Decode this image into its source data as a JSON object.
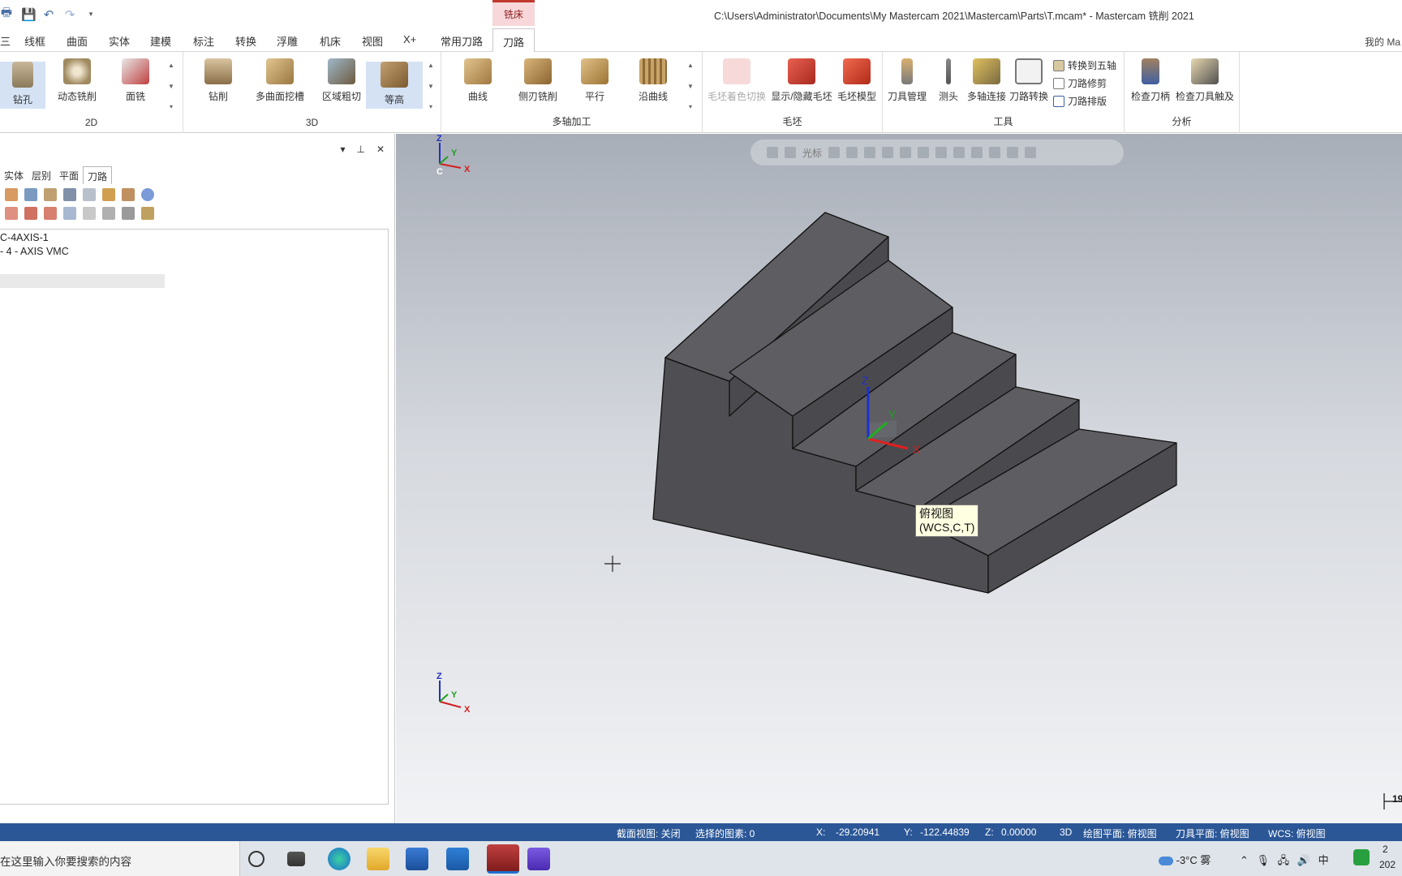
{
  "window": {
    "title": "C:\\Users\\Administrator\\Documents\\My Mastercam 2021\\Mastercam\\Parts\\T.mcam* - Mastercam 铣削 2021",
    "context_tab": "铣床",
    "account": "我的 Ma"
  },
  "tabs": [
    "三",
    "线框",
    "曲面",
    "实体",
    "建模",
    "标注",
    "转换",
    "浮雕",
    "机床",
    "视图",
    "X+",
    "常用刀路",
    "刀路"
  ],
  "ribbon": {
    "group_2d": {
      "label": "2D",
      "buttons": [
        "钻孔",
        "动态铣削",
        "面铣"
      ]
    },
    "group_3d": {
      "label": "3D",
      "buttons": [
        "钻削",
        "多曲面挖槽",
        "区域粗切",
        "等高"
      ]
    },
    "group_multiaxis": {
      "label": "多轴加工",
      "buttons": [
        "曲线",
        "侧刃铣削",
        "平行",
        "沿曲线"
      ]
    },
    "group_stock": {
      "label": "毛坯",
      "buttons": [
        "毛坯着色切换",
        "显示/隐藏毛坯",
        "毛坯模型"
      ]
    },
    "group_tools": {
      "label": "工具",
      "buttons": [
        "刀具管理",
        "测头",
        "多轴连接",
        "刀路转换"
      ],
      "small": [
        "转换到五轴",
        "刀路修剪",
        "刀路排版"
      ]
    },
    "group_analysis": {
      "label": "分析",
      "buttons": [
        "检查刀柄",
        "检查刀具触及"
      ]
    }
  },
  "manager": {
    "tabs": [
      "实体",
      "层别",
      "平面",
      "刀路"
    ],
    "active_tab": "刀路",
    "tree": [
      "C-4AXIS-1",
      "- 4 - AXIS VMC"
    ]
  },
  "viewport": {
    "toolbar_label": "光标",
    "tooltip": [
      "俯视图",
      "(WCS,C,T)"
    ],
    "axes": {
      "x": "X",
      "y": "Y",
      "z": "Z",
      "c": "C"
    },
    "scale_mark": "19"
  },
  "status": {
    "section_view": "截面视图: 关闭",
    "selected": "选择的图素: 0",
    "x_label": "X:",
    "x": "-29.20941",
    "y_label": "Y:",
    "y": "-122.44839",
    "z_label": "Z:",
    "z": "0.00000",
    "mode": "3D",
    "cplane": "绘图平面: 俯视图",
    "tplane": "刀具平面: 俯视图",
    "wcs": "WCS: 俯视图"
  },
  "taskbar": {
    "search_placeholder": "在这里输入你要搜索的内容",
    "weather": "-3°C 雾",
    "ime": "中",
    "clock_top": "2",
    "clock_bottom": "202"
  },
  "colors": {
    "accent": "#2b5797",
    "solid_face": "#4f4f52",
    "solid_top": "#5c5c60",
    "axis_x": "#d02020",
    "axis_y": "#20a020",
    "axis_z": "#2030c0"
  }
}
